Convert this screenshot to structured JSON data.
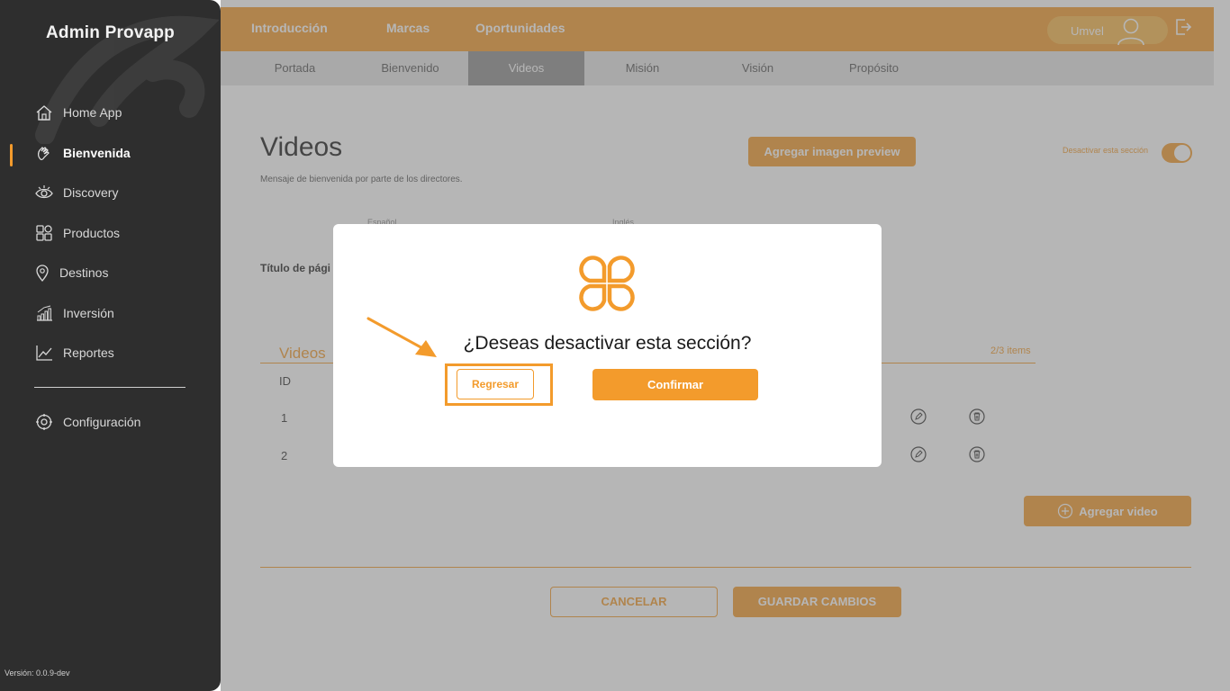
{
  "sidebar": {
    "brand": "Admin Provapp",
    "items": [
      {
        "label": "Home App",
        "icon": "home-icon"
      },
      {
        "label": "Bienvenida",
        "icon": "hand-wave-icon"
      },
      {
        "label": "Discovery",
        "icon": "eye-icon"
      },
      {
        "label": "Productos",
        "icon": "grid-shapes-icon"
      },
      {
        "label": "Destinos",
        "icon": "map-pin-icon"
      },
      {
        "label": "Inversión",
        "icon": "bar-chart-icon"
      },
      {
        "label": "Reportes",
        "icon": "line-chart-icon"
      }
    ],
    "settings": {
      "label": "Configuración",
      "icon": "gear-icon"
    },
    "active_item": "Bienvenida",
    "version": "Versión: 0.0.9-dev"
  },
  "topnav": {
    "tabs": [
      "Introducción",
      "Marcas",
      "Oportunidades"
    ],
    "user_name": "Umvel"
  },
  "subnav": {
    "tabs": [
      "Portada",
      "Bienvenido",
      "Videos",
      "Misión",
      "Visión",
      "Propósito"
    ],
    "active": "Videos"
  },
  "main": {
    "title": "Videos",
    "subtitle": "Mensaje de bienvenida por parte de los directores.",
    "preview_button": "Agregar imagen preview",
    "toggle_label": "Desactivar esta sección",
    "toggle_on": true,
    "hint_es": "Español",
    "hint_en": "Inglés",
    "field_label": "Título de pági",
    "videos_heading": "Videos",
    "items_count": "2/3 items",
    "id_header": "ID",
    "rows": [
      {
        "id": "1"
      },
      {
        "id": "2"
      }
    ],
    "add_video_button": "Agregar video",
    "cancel_button": "CANCELAR",
    "save_button": "GUARDAR CAMBIOS"
  },
  "modal": {
    "question": "¿Deseas desactivar esta sección?",
    "back_button": "Regresar",
    "confirm_button": "Confirmar"
  },
  "colors": {
    "accent": "#f39b2c",
    "sidebar_bg": "#2e2e2e",
    "overlay": "rgba(110,110,110,0.5)"
  }
}
